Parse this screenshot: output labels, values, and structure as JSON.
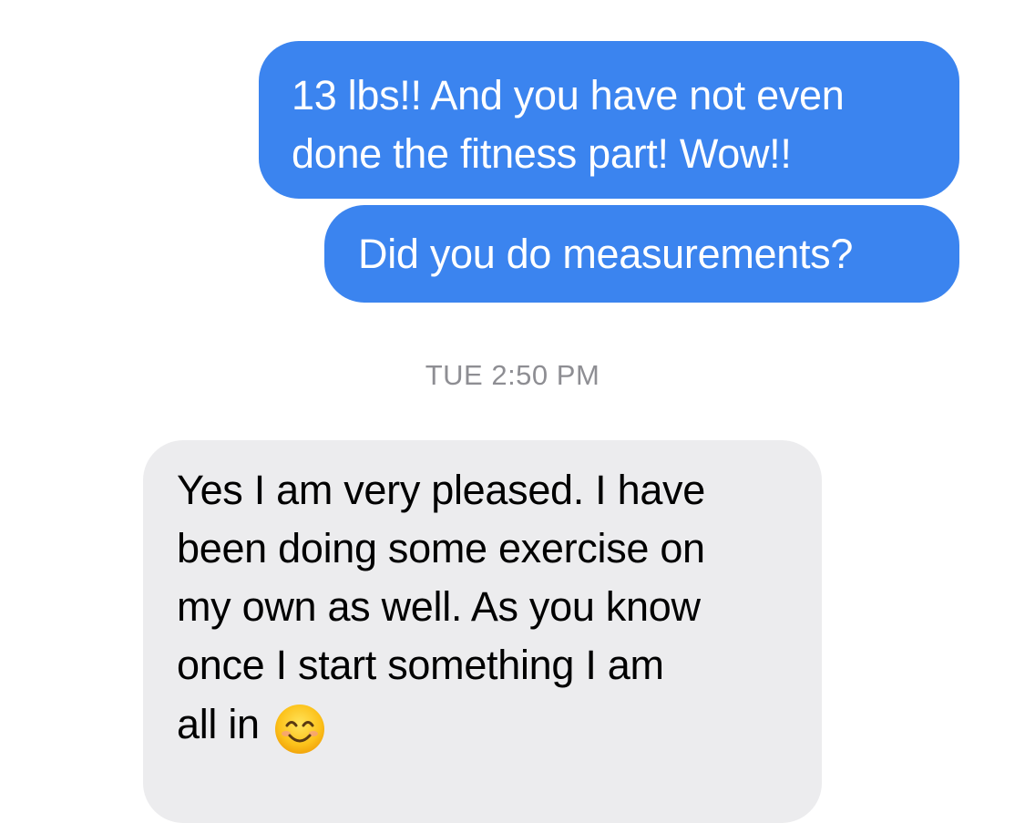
{
  "messages": [
    {
      "direction": "sent",
      "lines": [
        "13 lbs!! And you have not even",
        "done the fitness part! Wow!!"
      ]
    },
    {
      "direction": "sent",
      "lines": [
        "Did you do measurements?"
      ]
    },
    {
      "direction": "received",
      "lines": [
        "Yes I am very pleased.  I have",
        "been doing some exercise on",
        "my own as well.  As you know",
        "once I start something I am",
        "all in"
      ],
      "emoji": "smiling-face-with-smiling-eyes"
    }
  ],
  "timestamp": "TUE 2:50 PM",
  "colors": {
    "sent_bubble": "#3b84ef",
    "received_bubble": "#ececee",
    "timestamp_text": "#8e8e93"
  }
}
